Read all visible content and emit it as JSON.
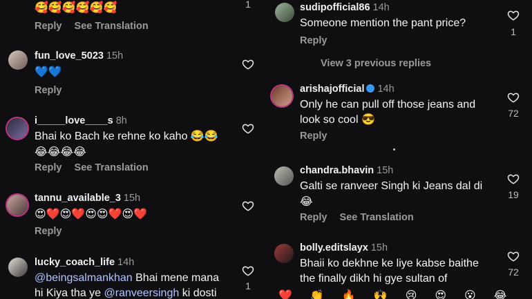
{
  "left": {
    "top_comment": {
      "emojis": "🥰🥰🥰🥰🥰🥰",
      "actions": [
        "Reply",
        "See Translation"
      ],
      "likes": "1"
    },
    "comments": [
      {
        "username": "fun_love_5023",
        "time": "15h",
        "text": "💙💙",
        "actions": [
          "Reply"
        ],
        "likes": ""
      },
      {
        "username": "i_____love____s",
        "time": "8h",
        "text_line1": "Bhai ko Bach ke rehne ko kaho 😂😂",
        "text_line2": "😂😂😂😂",
        "actions": [
          "Reply",
          "See Translation"
        ],
        "likes": ""
      },
      {
        "username": "tannu_available_3",
        "time": "15h",
        "text": "😍❤️😍❤️😍😍❤️😍❤️",
        "actions": [
          "Reply"
        ],
        "likes": ""
      },
      {
        "username": "lucky_coach_life",
        "time": "14h",
        "mention1": "@beingsalmankhan",
        "text_a": " Bhai mene mana",
        "text_b": "hi Kiya tha ye ",
        "mention2": "@ranveersingh",
        "text_c": "  ki dosti",
        "likes": "1"
      }
    ]
  },
  "right": {
    "comments": [
      {
        "username": "sudipofficial86",
        "time": "14h",
        "text": "Someone mention the pant price?",
        "actions": [
          "Reply"
        ],
        "likes": "1"
      },
      {
        "username": "arishajofficial",
        "time": "14h",
        "text_line1": "Only he can pull off those jeans and",
        "text_line2": "look so cool 😎",
        "actions": [
          "Reply"
        ],
        "likes": "72",
        "verified": true
      },
      {
        "username": "chandra.bhavin",
        "time": "15h",
        "text_line1": "Galti se ranveer Singh ki Jeans dal di",
        "text_line2": "😂",
        "actions": [
          "Reply",
          "See Translation"
        ],
        "likes": "19"
      },
      {
        "username": "bolly.editslayx",
        "time": "15h",
        "text_line1": "Bhaii ko dekhne ke liye kabse baithe",
        "text_line2": "the finally dikh hi gye sultan of",
        "likes": "72"
      }
    ],
    "view_previous": "View 3 previous replies"
  },
  "reactions": "❤️👏🔥🙌😢😍😮😂",
  "colors": {
    "background": "#0f0f12",
    "muted": "#9a9a9a",
    "mention": "#b0c4ff",
    "verified": "#3897f0",
    "story_ring": "#c13584"
  }
}
